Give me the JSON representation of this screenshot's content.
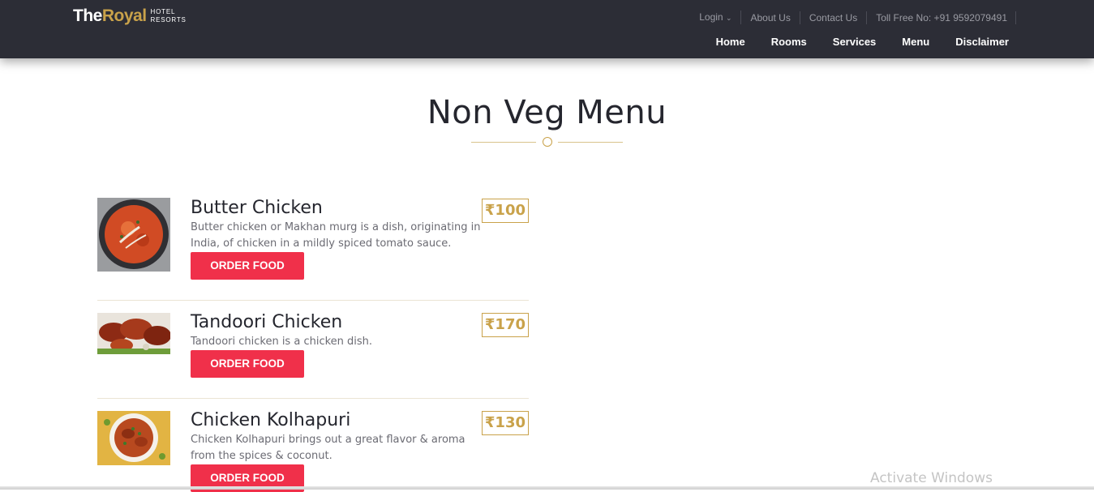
{
  "brand": {
    "the": "The",
    "royal": "Royal",
    "sub1": "HOTEL",
    "sub2": "RESORTS"
  },
  "topnav": {
    "login": "Login",
    "about": "About Us",
    "contact": "Contact Us",
    "tollfree": "Toll Free No: +91 9592079491"
  },
  "mainnav": {
    "home": "Home",
    "rooms": "Rooms",
    "services": "Services",
    "menu": "Menu",
    "disclaimer": "Disclaimer"
  },
  "page": {
    "title": "Non Veg Menu"
  },
  "items": [
    {
      "name": "Butter Chicken",
      "price": "₹100",
      "desc": "Butter chicken or Makhan murg is a dish, originating in India, of chicken in a mildly spiced tomato sauce.",
      "button": "ORDER FOOD"
    },
    {
      "name": "Tandoori Chicken",
      "price": "₹170",
      "desc": "Tandoori chicken is a chicken dish.",
      "button": "ORDER FOOD"
    },
    {
      "name": "Chicken Kolhapuri",
      "price": "₹130",
      "desc": "Chicken Kolhapuri brings out a great flavor & aroma from the spices & coconut.",
      "button": "ORDER FOOD"
    }
  ],
  "watermark": "Activate Windows",
  "colors": {
    "header": "#2c2d36",
    "accent": "#c9a24a",
    "button": "#f0304a"
  }
}
